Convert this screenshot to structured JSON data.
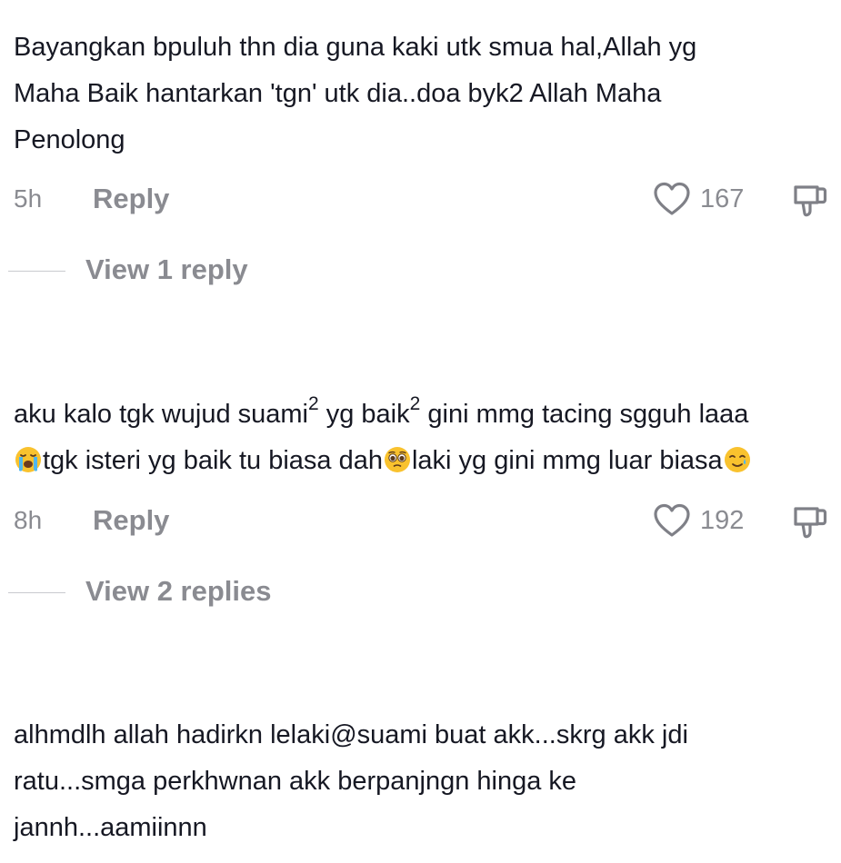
{
  "comments": [
    {
      "lines": [
        "Bayangkan bpuluh thn dia guna kaki utk smua hal,Allah yg",
        "Maha Baik hantarkan 'tgn' utk dia..doa byk2 Allah Maha",
        "Penolong"
      ],
      "time": "5h",
      "reply_label": "Reply",
      "likes": "167",
      "view_replies": "View 1 reply"
    },
    {
      "line1": {
        "a": "aku kalo tgk wujud suami",
        "sup1": "2",
        "b": " yg baik",
        "sup2": "2",
        "c": " gini mmg tacing sgguh laaa"
      },
      "line2": {
        "emoji1": "loudly-crying-face",
        "a": "tgk isteri yg baik tu biasa dah",
        "emoji2": "pleading-face",
        "b": "laki yg gini mmg luar biasa",
        "emoji3": "smiling-face-with-tear"
      },
      "time": "8h",
      "reply_label": "Reply",
      "likes": "192",
      "view_replies": "View 2 replies"
    },
    {
      "lines": [
        "alhmdlh allah hadirkn lelaki@suami buat akk...skrg akk jdi",
        "ratu...smga perkhwnan akk berpanjngn hinga ke",
        "jannh...aamiinnn"
      ]
    }
  ],
  "colors": {
    "text": "#161823",
    "meta": "#8a8b91",
    "emoji_yellow": "#f9c22e"
  }
}
